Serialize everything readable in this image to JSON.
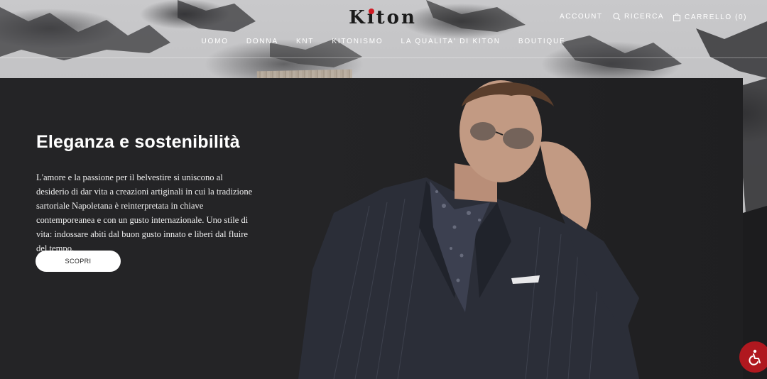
{
  "brand": {
    "logo_text": "Kiton",
    "accent": "#d11b24"
  },
  "header": {
    "account_label": "ACCOUNT",
    "search_label": "RICERCA",
    "cart_label": "CARRELLO (0)"
  },
  "nav": {
    "items": [
      {
        "label": "UOMO"
      },
      {
        "label": "DONNA"
      },
      {
        "label": "KNT"
      },
      {
        "label": "KITONISMO"
      },
      {
        "label": "LA QUALITA' DI KITON"
      },
      {
        "label": "BOUTIQUE"
      }
    ]
  },
  "hero": {
    "title": "Eleganza e sostenibilità",
    "body": "L'amore e la passione per il belvestire si uniscono al desiderio di dar vita a creazioni artiginali in cui la tradizione sartoriale Napoletana è reinterpretata in chiave contemporeanea e con un gusto internazionale. Uno stile di vita: indossare abiti dal buon gusto innato e liberi dal fluire del tempo.",
    "cta_label": "SCOPRI"
  },
  "accessibility": {
    "icon": "accessibility-icon",
    "color": "#b0181f"
  }
}
